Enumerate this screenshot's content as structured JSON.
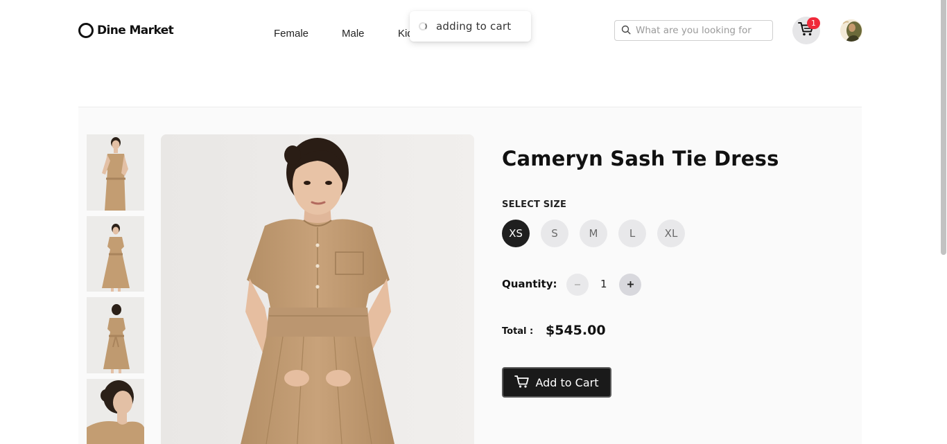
{
  "brand": {
    "name": "Dine Market"
  },
  "nav": {
    "female": "Female",
    "male": "Male",
    "kids": "Kids"
  },
  "toast": {
    "message": "adding to cart"
  },
  "search": {
    "placeholder": "What are you looking for",
    "value": ""
  },
  "cart": {
    "count": "1"
  },
  "product": {
    "title": "Cameryn Sash Tie Dress",
    "size_label": "SELECT SIZE",
    "sizes": [
      "XS",
      "S",
      "M",
      "L",
      "XL"
    ],
    "selected_size": "XS",
    "quantity_label": "Quantity:",
    "quantity": "1",
    "total_label": "Total :",
    "total": "$545.00",
    "add_to_cart": "Add to Cart"
  },
  "colors": {
    "primary": "#1a1a1a",
    "badge": "#f0293a",
    "dress": "#c09a72"
  },
  "icons": {
    "search": "search-icon",
    "cart": "cart-icon",
    "spinner": "spinner-icon"
  }
}
